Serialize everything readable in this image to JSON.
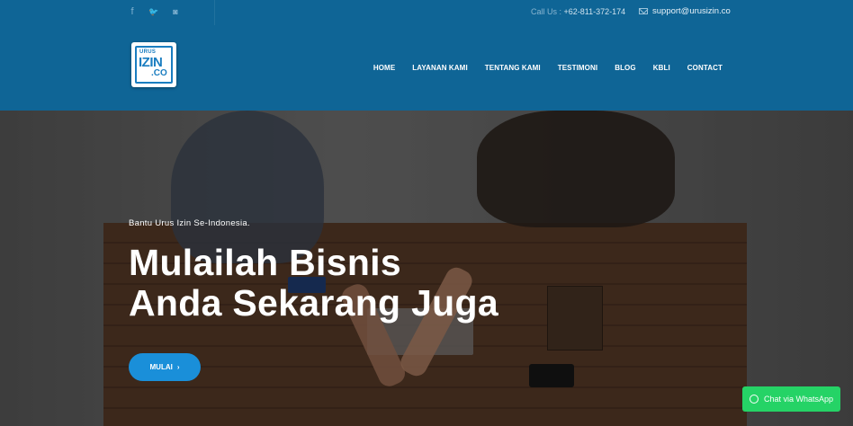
{
  "topbar": {
    "social": [
      {
        "name": "facebook-icon",
        "glyph": "f"
      },
      {
        "name": "twitter-icon",
        "glyph": "🐦"
      },
      {
        "name": "instagram-icon",
        "glyph": "◙"
      }
    ],
    "call_label": "Call Us :",
    "call_number": "+62-811-372-174",
    "email": "support@urusizin.co"
  },
  "logo": {
    "top": "URUS",
    "main": "IZIN",
    "sub": ".CO"
  },
  "nav": [
    "HOME",
    "LAYANAN KAMI",
    "TENTANG KAMI",
    "TESTIMONI",
    "BLOG",
    "KBLI",
    "CONTACT"
  ],
  "hero": {
    "tagline": "Bantu Urus Izin Se-Indonesia.",
    "headline_line1": "Mulailah Bisnis",
    "headline_line2": "Anda Sekarang Juga",
    "cta_label": "MULAI",
    "cta_arrow": "›"
  },
  "whatsapp": {
    "label": "Chat via WhatsApp"
  },
  "colors": {
    "header": "#0f6596",
    "cta": "#1a8fd9",
    "whatsapp": "#25d366"
  }
}
